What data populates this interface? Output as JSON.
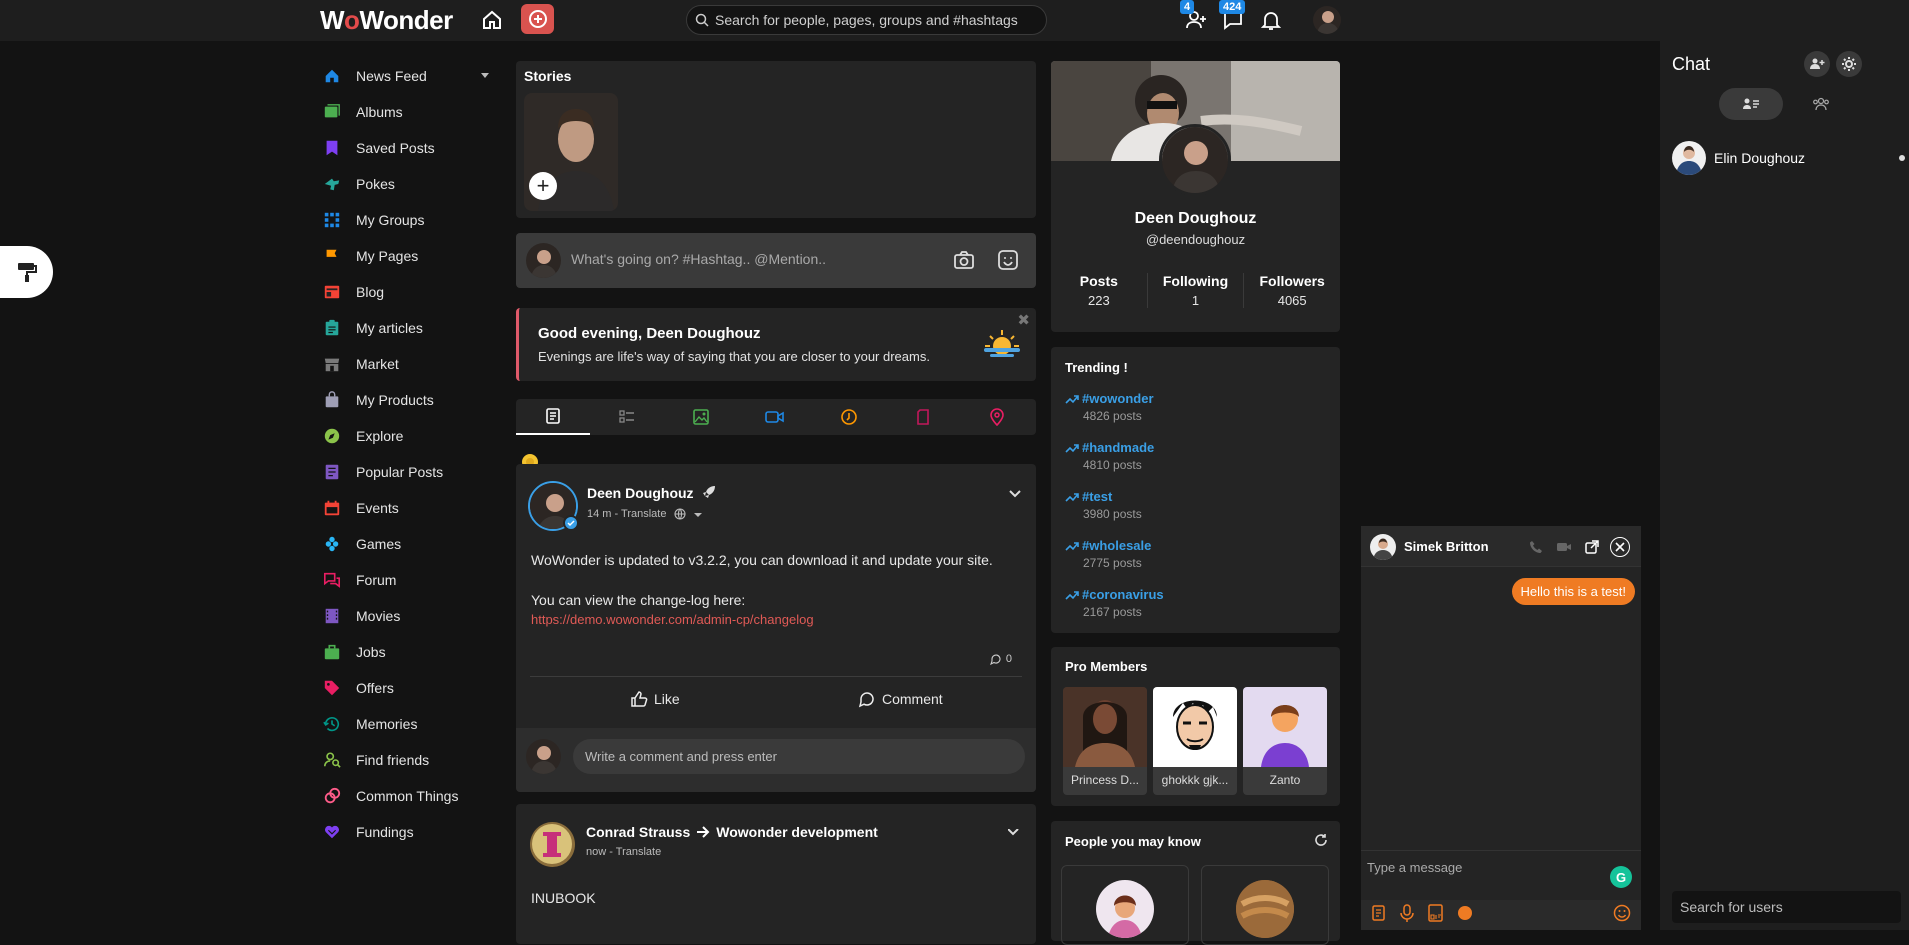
{
  "brand": {
    "logo_pre": "W",
    "logo_oo": "o",
    "logo_post": "Wonder"
  },
  "search": {
    "placeholder": "Search for people, pages, groups and #hashtags"
  },
  "top": {
    "friend_badge": "4",
    "msg_badge": "424"
  },
  "sidebar": {
    "items": [
      {
        "label": "News Feed",
        "icon": "home-icon",
        "color": "#1e88e5"
      },
      {
        "label": "Albums",
        "icon": "image-icon",
        "color": "#4caf50"
      },
      {
        "label": "Saved Posts",
        "icon": "bookmark-icon",
        "color": "#7e3ff2"
      },
      {
        "label": "Pokes",
        "icon": "poke-icon",
        "color": "#26a69a"
      },
      {
        "label": "My Groups",
        "icon": "groups-icon",
        "color": "#1e88e5"
      },
      {
        "label": "My Pages",
        "icon": "flag-icon",
        "color": "#ff9800"
      },
      {
        "label": "Blog",
        "icon": "blog-icon",
        "color": "#f44336"
      },
      {
        "label": "My articles",
        "icon": "articles-icon",
        "color": "#26a69a"
      },
      {
        "label": "Market",
        "icon": "market-icon",
        "color": "#7a7a7a"
      },
      {
        "label": "My Products",
        "icon": "products-icon",
        "color": "#9e9eb5"
      },
      {
        "label": "Explore",
        "icon": "explore-icon",
        "color": "#8bc34a"
      },
      {
        "label": "Popular Posts",
        "icon": "popular-icon",
        "color": "#7e57c2"
      },
      {
        "label": "Events",
        "icon": "calendar-icon",
        "color": "#f44336"
      },
      {
        "label": "Games",
        "icon": "games-icon",
        "color": "#29b6f6"
      },
      {
        "label": "Forum",
        "icon": "forum-icon",
        "color": "#e91e63"
      },
      {
        "label": "Movies",
        "icon": "movies-icon",
        "color": "#7e57c2"
      },
      {
        "label": "Jobs",
        "icon": "jobs-icon",
        "color": "#4caf50"
      },
      {
        "label": "Offers",
        "icon": "offers-icon",
        "color": "#e91e63"
      },
      {
        "label": "Memories",
        "icon": "memories-icon",
        "color": "#009688"
      },
      {
        "label": "Find friends",
        "icon": "find-friends-icon",
        "color": "#8bc34a"
      },
      {
        "label": "Common Things",
        "icon": "common-things-icon",
        "color": "#ff5c8a"
      },
      {
        "label": "Fundings",
        "icon": "fundings-icon",
        "color": "#7e3ff2"
      }
    ]
  },
  "stories": {
    "title": "Stories"
  },
  "composer": {
    "placeholder": "What's going on? #Hashtag.. @Mention.."
  },
  "greeting": {
    "title": "Good evening, Deen Doughouz",
    "text": "Evenings are life's way of saying that you are closer to your dreams."
  },
  "post1": {
    "author": "Deen Doughouz",
    "meta": "14 m - Translate",
    "line1": "WoWonder is updated to v3.2.2, you can download it and update your site.",
    "line2": "You can view the change-log here:",
    "link": "https://demo.wowonder.com/admin-cp/changelog",
    "comments": "0",
    "like": "Like",
    "comment": "Comment",
    "comment_placeholder": "Write a comment and press enter"
  },
  "post2": {
    "author": "Conrad Strauss",
    "target": "Wowonder development",
    "meta": "now - Translate",
    "text": "INUBOOK"
  },
  "profile": {
    "name": "Deen Doughouz",
    "handle": "@deendoughouz",
    "stats": [
      {
        "label": "Posts",
        "value": "223"
      },
      {
        "label": "Following",
        "value": "1"
      },
      {
        "label": "Followers",
        "value": "4065"
      }
    ]
  },
  "trending": {
    "title": "Trending !",
    "items": [
      {
        "tag": "#wowonder",
        "count": "4826 posts"
      },
      {
        "tag": "#handmade",
        "count": "4810 posts"
      },
      {
        "tag": "#test",
        "count": "3980 posts"
      },
      {
        "tag": "#wholesale",
        "count": "2775 posts"
      },
      {
        "tag": "#coronavirus",
        "count": "2167 posts"
      }
    ]
  },
  "pro": {
    "title": "Pro Members",
    "members": [
      {
        "name": "Princess D..."
      },
      {
        "name": "ghokkk gjk..."
      },
      {
        "name": "Zanto"
      }
    ]
  },
  "pymk": {
    "title": "People you may know"
  },
  "chat": {
    "title": "Chat",
    "user": "Elin Doughouz",
    "search_placeholder": "Search for users"
  },
  "chatwin": {
    "name": "Simek Britton",
    "message": "Hello this is a test!",
    "placeholder": "Type a message",
    "grammarly": "G"
  }
}
